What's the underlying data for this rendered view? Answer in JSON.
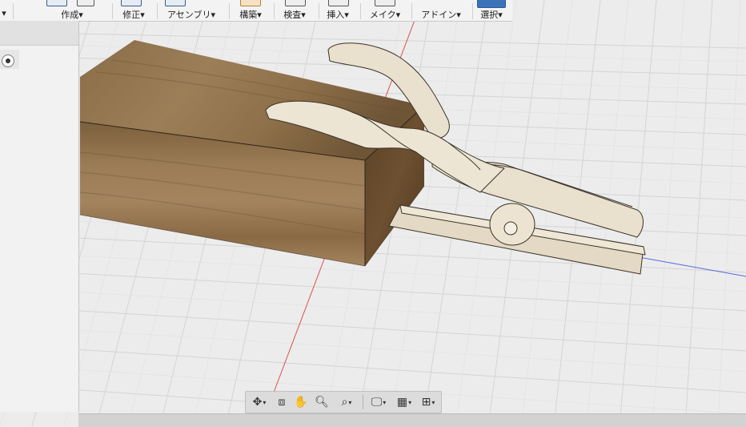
{
  "toolbar": {
    "left_caret": "▾",
    "groups": [
      {
        "label": "作成▾"
      },
      {
        "label": "修正▾"
      },
      {
        "label": "アセンブリ▾"
      },
      {
        "label": "構築▾"
      },
      {
        "label": "検査▾"
      },
      {
        "label": "挿入▾"
      },
      {
        "label": "メイク▾"
      },
      {
        "label": "アドイン▾"
      },
      {
        "label": "選択▾"
      }
    ]
  },
  "nav": {
    "orbit_icon": "orbit-icon",
    "look_icon": "look-at-icon",
    "pan_icon": "pan-hand-icon",
    "zoom_icon": "zoom-icon",
    "fit_icon": "zoom-window-icon",
    "display_icon": "display-settings-icon",
    "grid_icon": "grid-settings-icon",
    "viewports_icon": "viewports-icon"
  },
  "colors": {
    "grid_background": "#ececec",
    "grid_minor": "#d8d8d8",
    "grid_major": "#c6c6c6",
    "axis_red": "#e05050",
    "axis_blue": "#5060e0",
    "wood_light": "#9a7a52",
    "wood_dark": "#6f5232",
    "clamp_fill": "#e9e0cd",
    "clamp_shade": "#d8ccb2",
    "selection_blue": "#3b73b9"
  }
}
